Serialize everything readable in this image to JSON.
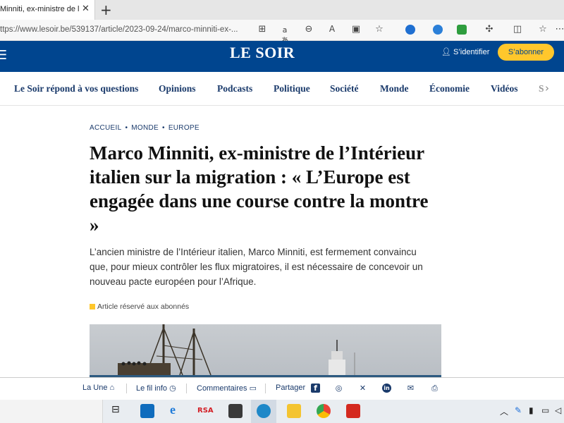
{
  "browser": {
    "tab_title": "Minniti, ex-ministre de l’Int",
    "tab_close": "✕",
    "new_tab": "+",
    "url": "ttps://www.lesoir.be/539137/article/2023-09-24/marco-minniti-ex-...",
    "toolbar_icons": [
      "grid-apps-icon",
      "read-aloud-icon",
      "zoom-icon",
      "text-size-icon",
      "reader-icon",
      "favorite-star-icon",
      "extension-shield-icon",
      "extension-drop-icon",
      "extension-green-icon",
      "extensions-puzzle-icon",
      "split-screen-icon",
      "favorites-list-icon",
      "more-icon"
    ]
  },
  "site": {
    "logo": "LE SOIR",
    "login_label": "S’identifier",
    "subscribe_label": "S’abonner"
  },
  "nav": {
    "items": [
      "Le Soir répond à vos questions",
      "Opinions",
      "Podcasts",
      "Politique",
      "Société",
      "Monde",
      "Économie",
      "Vidéos",
      "S"
    ]
  },
  "article": {
    "breadcrumb": [
      "ACCUEIL",
      "MONDE",
      "EUROPE"
    ],
    "headline": "Marco Minniti, ex-ministre de l’Intérieur italien sur la migration : « L’Europe est engagée dans une course contre la montre »",
    "lead": "L’ancien ministre de l’Intérieur italien, Marco Minniti, est fermement convaincu que, pour mieux contrôler les flux migratoires, il est nécessaire de concevoir un nouveau pacte européen pour l’Afrique.",
    "premium_label": "Article réservé aux abonnés"
  },
  "sharebar": {
    "home_label": "La Une",
    "feed_label": "Le fil info",
    "comments_label": "Commentaires",
    "share_label": "Partager"
  },
  "taskbar": {
    "apps": [
      "task-view-icon",
      "outlook-icon",
      "internet-explorer-icon",
      "rsa-icon",
      "terminal-icon",
      "edge-icon",
      "file-explorer-icon",
      "chrome-icon",
      "acrobat-icon"
    ],
    "rsa_label": "RSA"
  },
  "colors": {
    "header_blue": "#00458f",
    "accent_yellow": "#ffc72c",
    "nav_text": "#1a3a6b"
  }
}
